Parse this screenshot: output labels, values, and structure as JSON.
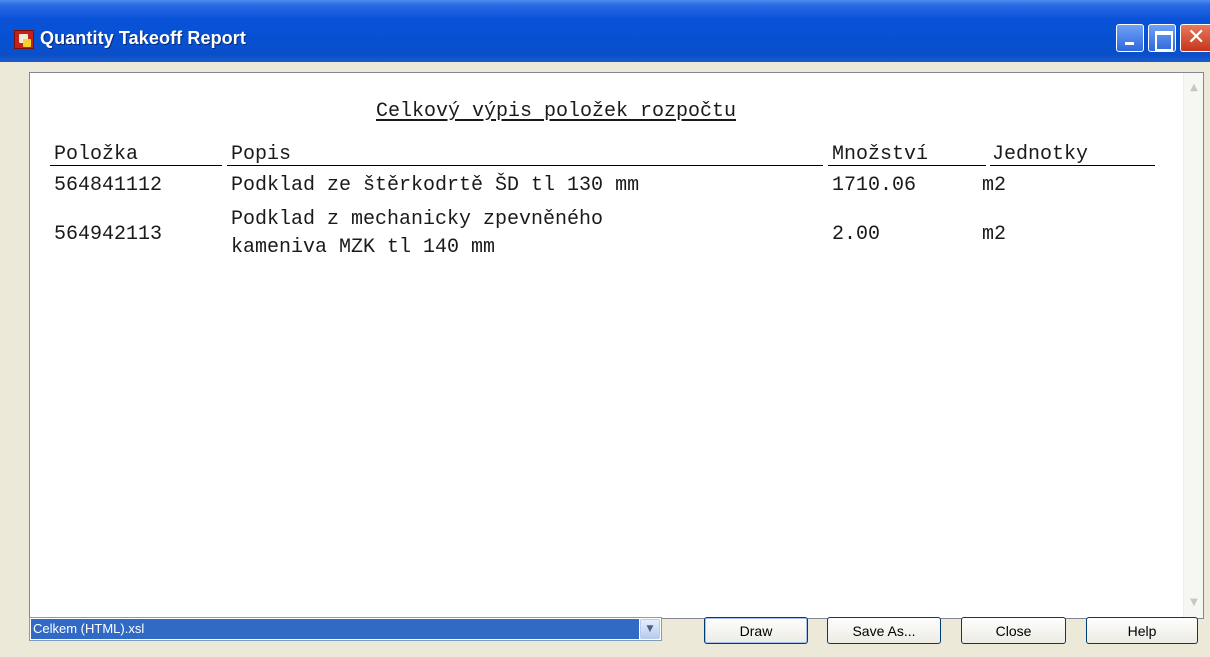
{
  "window": {
    "title": "Quantity Takeoff Report",
    "close_glyph": "✕",
    "icons": {
      "app": "app-icon",
      "minimize": "minimize-icon",
      "maximize": "maximize-icon",
      "close": "close-icon"
    }
  },
  "report": {
    "title": "Celkový výpis položek rozpočtu",
    "columns": {
      "item": "Položka",
      "description": "Popis",
      "quantity": "Množství",
      "units": "Jednotky"
    },
    "rows": [
      {
        "item": "564841112",
        "description": "Podklad ze štěrkodrtě ŠD tl 130 mm",
        "quantity": "1710.06",
        "units": "m2"
      },
      {
        "item": "564942113",
        "description_line1": "Podklad z mechanicky zpevněného",
        "description_line2": "kameniva MZK tl 140 mm",
        "quantity": "2.00",
        "units": "m2"
      }
    ],
    "scroll_up_glyph": "▲",
    "scroll_down_glyph": "▼"
  },
  "bottom": {
    "template_select_value": "Celkem (HTML).xsl",
    "dropdown_glyph": "▼",
    "buttons": {
      "draw": "Draw",
      "save_as": "Save As...",
      "close": "Close",
      "help": "Help"
    }
  },
  "colors": {
    "titlebar": "#0a53d8",
    "window_bg": "#ece9d8",
    "select_highlight": "#316ac5",
    "close_button": "#c6361c"
  }
}
